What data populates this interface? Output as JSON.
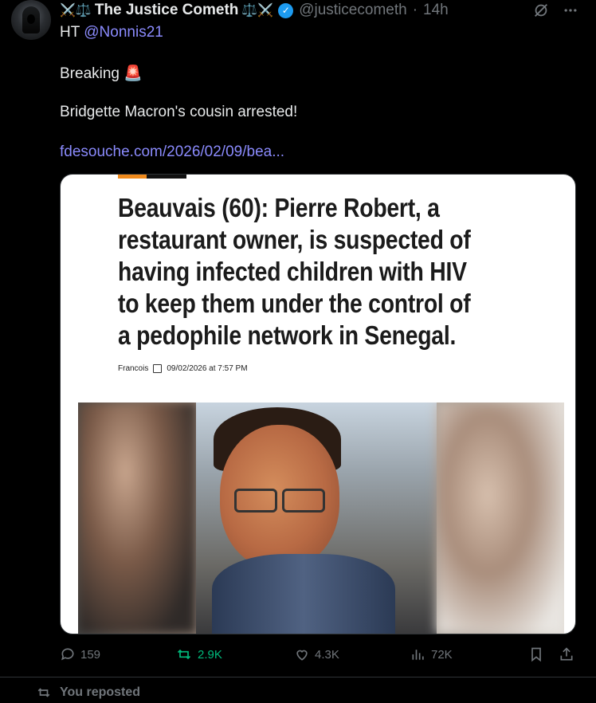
{
  "tweet": {
    "display_name": "The Justice Cometh",
    "name_prefix_emoji": "⚔️⚖️",
    "name_suffix_emoji": "⚖️⚔️",
    "handle": "@justicecometh",
    "separator": "·",
    "time": "14h",
    "line1_prefix": "HT",
    "line1_mention": "@Nonnis21",
    "line2": "Breaking",
    "line2_emoji": "🚨",
    "line3": "Bridgette Macron's cousin arrested!",
    "link": "fdesouche.com/2026/02/09/bea..."
  },
  "card": {
    "headline": "Beauvais (60): Pierre Robert, a restaurant owner, is suspected of having infected children with HIV to keep them under the control of a pedophile network in Senegal.",
    "author": "Francois",
    "date": "09/02/2026 at 7:57 PM"
  },
  "actions": {
    "replies": "159",
    "reposts": "2.9K",
    "likes": "4.3K",
    "views": "72K"
  },
  "footer": {
    "reposted_label": "You reposted"
  },
  "colors": {
    "background": "#000000",
    "text": "#e7e9ea",
    "muted": "#71767b",
    "link": "#8a8afc",
    "verified": "#1d9bf0",
    "repost_active": "#00ba7c"
  },
  "icons": {
    "verified": "verified-badge-icon",
    "grok": "grok-icon",
    "more": "more-icon",
    "reply": "reply-icon",
    "repost": "repost-icon",
    "like": "like-icon",
    "views": "views-icon",
    "bookmark": "bookmark-icon",
    "share": "share-icon"
  }
}
